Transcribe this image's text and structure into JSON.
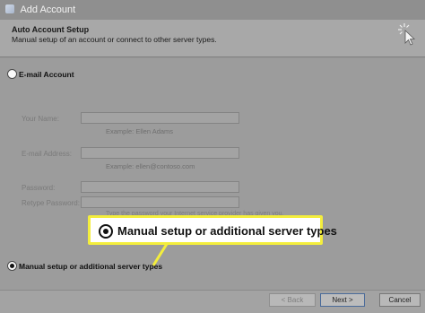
{
  "window": {
    "title": "Add Account"
  },
  "header": {
    "title": "Auto Account Setup",
    "subtitle": "Manual setup of an account or connect to other server types."
  },
  "options": {
    "email_account": {
      "label": "E-mail Account",
      "selected": false
    },
    "manual_setup": {
      "label": "Manual setup or additional server types",
      "selected": true
    }
  },
  "form": {
    "your_name_label": "Your Name:",
    "your_name_value": "",
    "your_name_example": "Example: Ellen Adams",
    "email_label": "E-mail Address:",
    "email_value": "",
    "email_example": "Example: ellen@contoso.com",
    "password_label": "Password:",
    "retype_label": "Retype Password:",
    "hint": "Type the password your Internet service provider has given you."
  },
  "callout": {
    "text": "Manual setup or additional server types"
  },
  "footer": {
    "back": "< Back",
    "next": "Next >",
    "cancel": "Cancel"
  },
  "colors": {
    "highlight_border": "#f4ee3c",
    "dim_overlay": "#9c9c9c"
  },
  "icons": {
    "wizard": "cursor-sparkle-icon"
  }
}
